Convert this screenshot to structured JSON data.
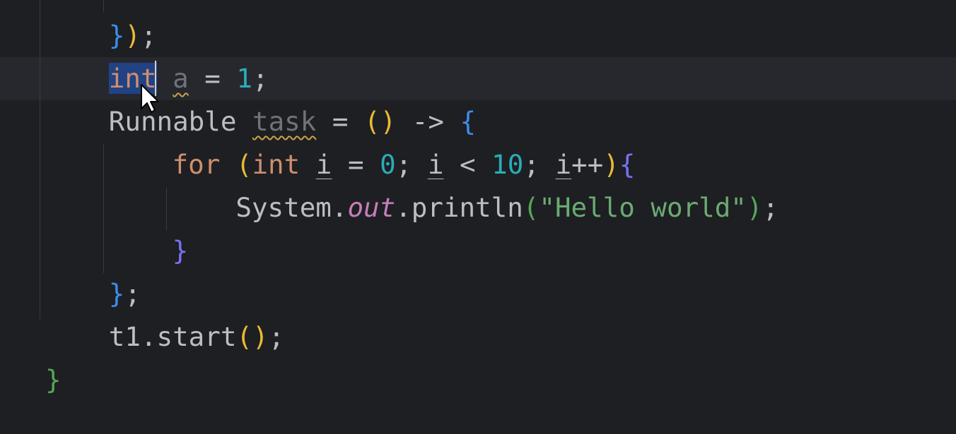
{
  "editor": {
    "language": "java",
    "colors": {
      "background": "#1e1f22",
      "current_line": "#26282e",
      "selection": "#214283",
      "keyword": "#cf8e6d",
      "number": "#2aacb8",
      "string": "#6aab73",
      "static_field": "#c77dbb",
      "identifier": "#bcbec4",
      "unused": "#6f737a",
      "warning_underline": "#c9a347",
      "bracket_yellow": "#e8ba36",
      "bracket_blue": "#3b8eea",
      "bracket_purple": "#7971f5",
      "bracket_green": "#54a857"
    },
    "lines": [
      {
        "indent": 4,
        "tokens": [
          {
            "text": "}",
            "cls": "b2"
          },
          {
            "text": ")",
            "cls": "b1"
          },
          {
            "text": ";",
            "cls": "plain"
          }
        ]
      },
      {
        "indent": 4,
        "current": true,
        "tokens": [
          {
            "text": "int",
            "cls": "kw sel"
          },
          {
            "text": " ",
            "cls": "plain"
          },
          {
            "text": "a",
            "cls": "unused warn"
          },
          {
            "text": " = ",
            "cls": "plain"
          },
          {
            "text": "1",
            "cls": "num"
          },
          {
            "text": ";",
            "cls": "plain"
          }
        ]
      },
      {
        "indent": 4,
        "tokens": [
          {
            "text": "Runnable ",
            "cls": "plain"
          },
          {
            "text": "task",
            "cls": "unused warn"
          },
          {
            "text": " = ",
            "cls": "plain"
          },
          {
            "text": "()",
            "cls": "b1"
          },
          {
            "text": " -> ",
            "cls": "plain"
          },
          {
            "text": "{",
            "cls": "b2"
          }
        ]
      },
      {
        "indent": 8,
        "tokens": [
          {
            "text": "for ",
            "cls": "kw"
          },
          {
            "text": "(",
            "cls": "b1"
          },
          {
            "text": "int ",
            "cls": "kw"
          },
          {
            "text": "i",
            "cls": "plain ul"
          },
          {
            "text": " = ",
            "cls": "plain"
          },
          {
            "text": "0",
            "cls": "num"
          },
          {
            "text": "; ",
            "cls": "plain"
          },
          {
            "text": "i",
            "cls": "plain ul"
          },
          {
            "text": " < ",
            "cls": "plain"
          },
          {
            "text": "10",
            "cls": "num"
          },
          {
            "text": "; ",
            "cls": "plain"
          },
          {
            "text": "i",
            "cls": "plain ul"
          },
          {
            "text": "++",
            "cls": "plain"
          },
          {
            "text": ")",
            "cls": "b1"
          },
          {
            "text": "{",
            "cls": "b3"
          }
        ]
      },
      {
        "indent": 12,
        "tokens": [
          {
            "text": "System.",
            "cls": "plain"
          },
          {
            "text": "out",
            "cls": "field"
          },
          {
            "text": ".println",
            "cls": "plain"
          },
          {
            "text": "(",
            "cls": "b4"
          },
          {
            "text": "\"Hello world\"",
            "cls": "str"
          },
          {
            "text": ")",
            "cls": "b4"
          },
          {
            "text": ";",
            "cls": "plain"
          }
        ]
      },
      {
        "indent": 8,
        "tokens": [
          {
            "text": "}",
            "cls": "b3"
          }
        ]
      },
      {
        "indent": 4,
        "tokens": [
          {
            "text": "}",
            "cls": "b2"
          },
          {
            "text": ";",
            "cls": "plain"
          }
        ]
      },
      {
        "indent": 4,
        "tokens": [
          {
            "text": "t1.start",
            "cls": "plain"
          },
          {
            "text": "()",
            "cls": "b1"
          },
          {
            "text": ";",
            "cls": "plain"
          }
        ]
      },
      {
        "indent": 0,
        "tokens": [
          {
            "text": "}",
            "cls": "b4"
          }
        ]
      }
    ]
  }
}
